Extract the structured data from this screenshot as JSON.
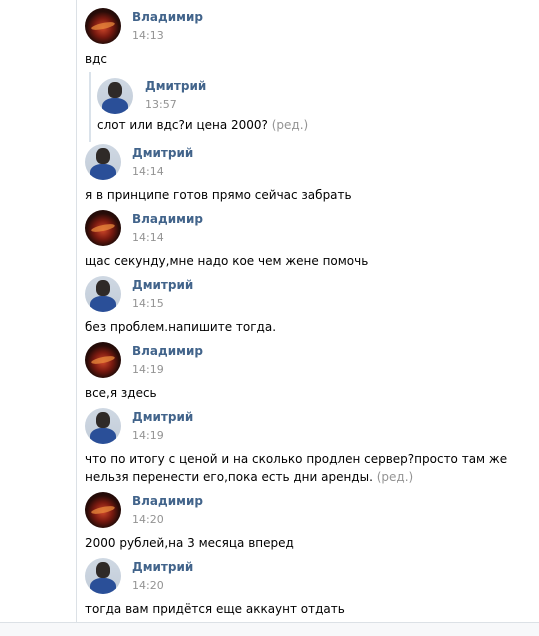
{
  "messages": [
    {
      "author": "Владимир",
      "avatar": "vladimir",
      "time": "14:13",
      "text": "вдс"
    },
    {
      "author": "Дмитрий",
      "avatar": "dmitry",
      "time": "14:14",
      "text": "я в принципе готов прямо сейчас забрать"
    },
    {
      "author": "Владимир",
      "avatar": "vladimir",
      "time": "14:14",
      "text": "щас секунду,мне надо кое чем жене помочь"
    },
    {
      "author": "Дмитрий",
      "avatar": "dmitry",
      "time": "14:15",
      "text": "без проблем.напишите тогда."
    },
    {
      "author": "Владимир",
      "avatar": "vladimir",
      "time": "14:19",
      "text": "все,я здесь"
    },
    {
      "author": "Дмитрий",
      "avatar": "dmitry",
      "time": "14:19",
      "text_line1": "что по итогу с ценой и на сколько продлен сервер?просто там же",
      "text_line2": "нельзя перенести его,пока есть дни аренды.",
      "edited": "(ред.)"
    },
    {
      "author": "Владимир",
      "avatar": "vladimir",
      "time": "14:20",
      "text": "2000 рублей,на 3 месяца вперед"
    },
    {
      "author": "Дмитрий",
      "avatar": "dmitry",
      "time": "14:20",
      "text": "тогда вам придётся еще аккаунт отдать"
    }
  ],
  "quote": {
    "author": "Дмитрий",
    "time": "13:57",
    "text": "слот или вдс?и цена 2000?",
    "edited": "(ред.)"
  },
  "colors": {
    "author": "#42648b",
    "time": "#939393",
    "text": "#000000",
    "background": "#edeef0"
  }
}
